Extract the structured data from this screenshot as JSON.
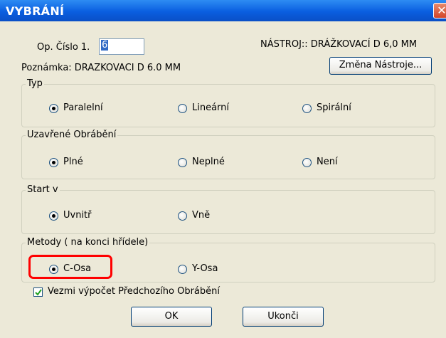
{
  "title": "VYBRÁNÍ",
  "close_glyph": "✕",
  "op": {
    "label": "Op. Číslo 1.",
    "value": "6"
  },
  "tool_label": "NÁSTROJ:: DRÁŽKOVACÍ D 6,0 MM",
  "note_label": "Poznámka: DRAZKOVACI D  6.0 MM",
  "change_tool_button": "Změna Nástroje...",
  "groups": {
    "typ": {
      "legend": "Typ",
      "options": [
        {
          "label": "Paralelní",
          "selected": true
        },
        {
          "label": "Lineární",
          "selected": false
        },
        {
          "label": "Spirální",
          "selected": false
        }
      ]
    },
    "closed": {
      "legend": "Uzavřené Obrábění",
      "options": [
        {
          "label": "Plné",
          "selected": true
        },
        {
          "label": "Neplné",
          "selected": false
        },
        {
          "label": "Není",
          "selected": false
        }
      ]
    },
    "start": {
      "legend": "Start v",
      "options": [
        {
          "label": "Uvnitř",
          "selected": true
        },
        {
          "label": "Vně",
          "selected": false
        }
      ]
    },
    "methods": {
      "legend": "Metody ( na konci hřídele)",
      "options": [
        {
          "label": "C-Osa",
          "selected": true
        },
        {
          "label": "Y-Osa",
          "selected": false
        }
      ]
    }
  },
  "checkbox": {
    "label": "Vezmi výpočet Předchozího Obrábění",
    "checked": true
  },
  "buttons": {
    "ok": "OK",
    "cancel": "Ukonči"
  },
  "colors": {
    "titlebar": "#0a5ee0",
    "dialog_bg": "#ece9d8",
    "highlight": "#ff0000"
  }
}
